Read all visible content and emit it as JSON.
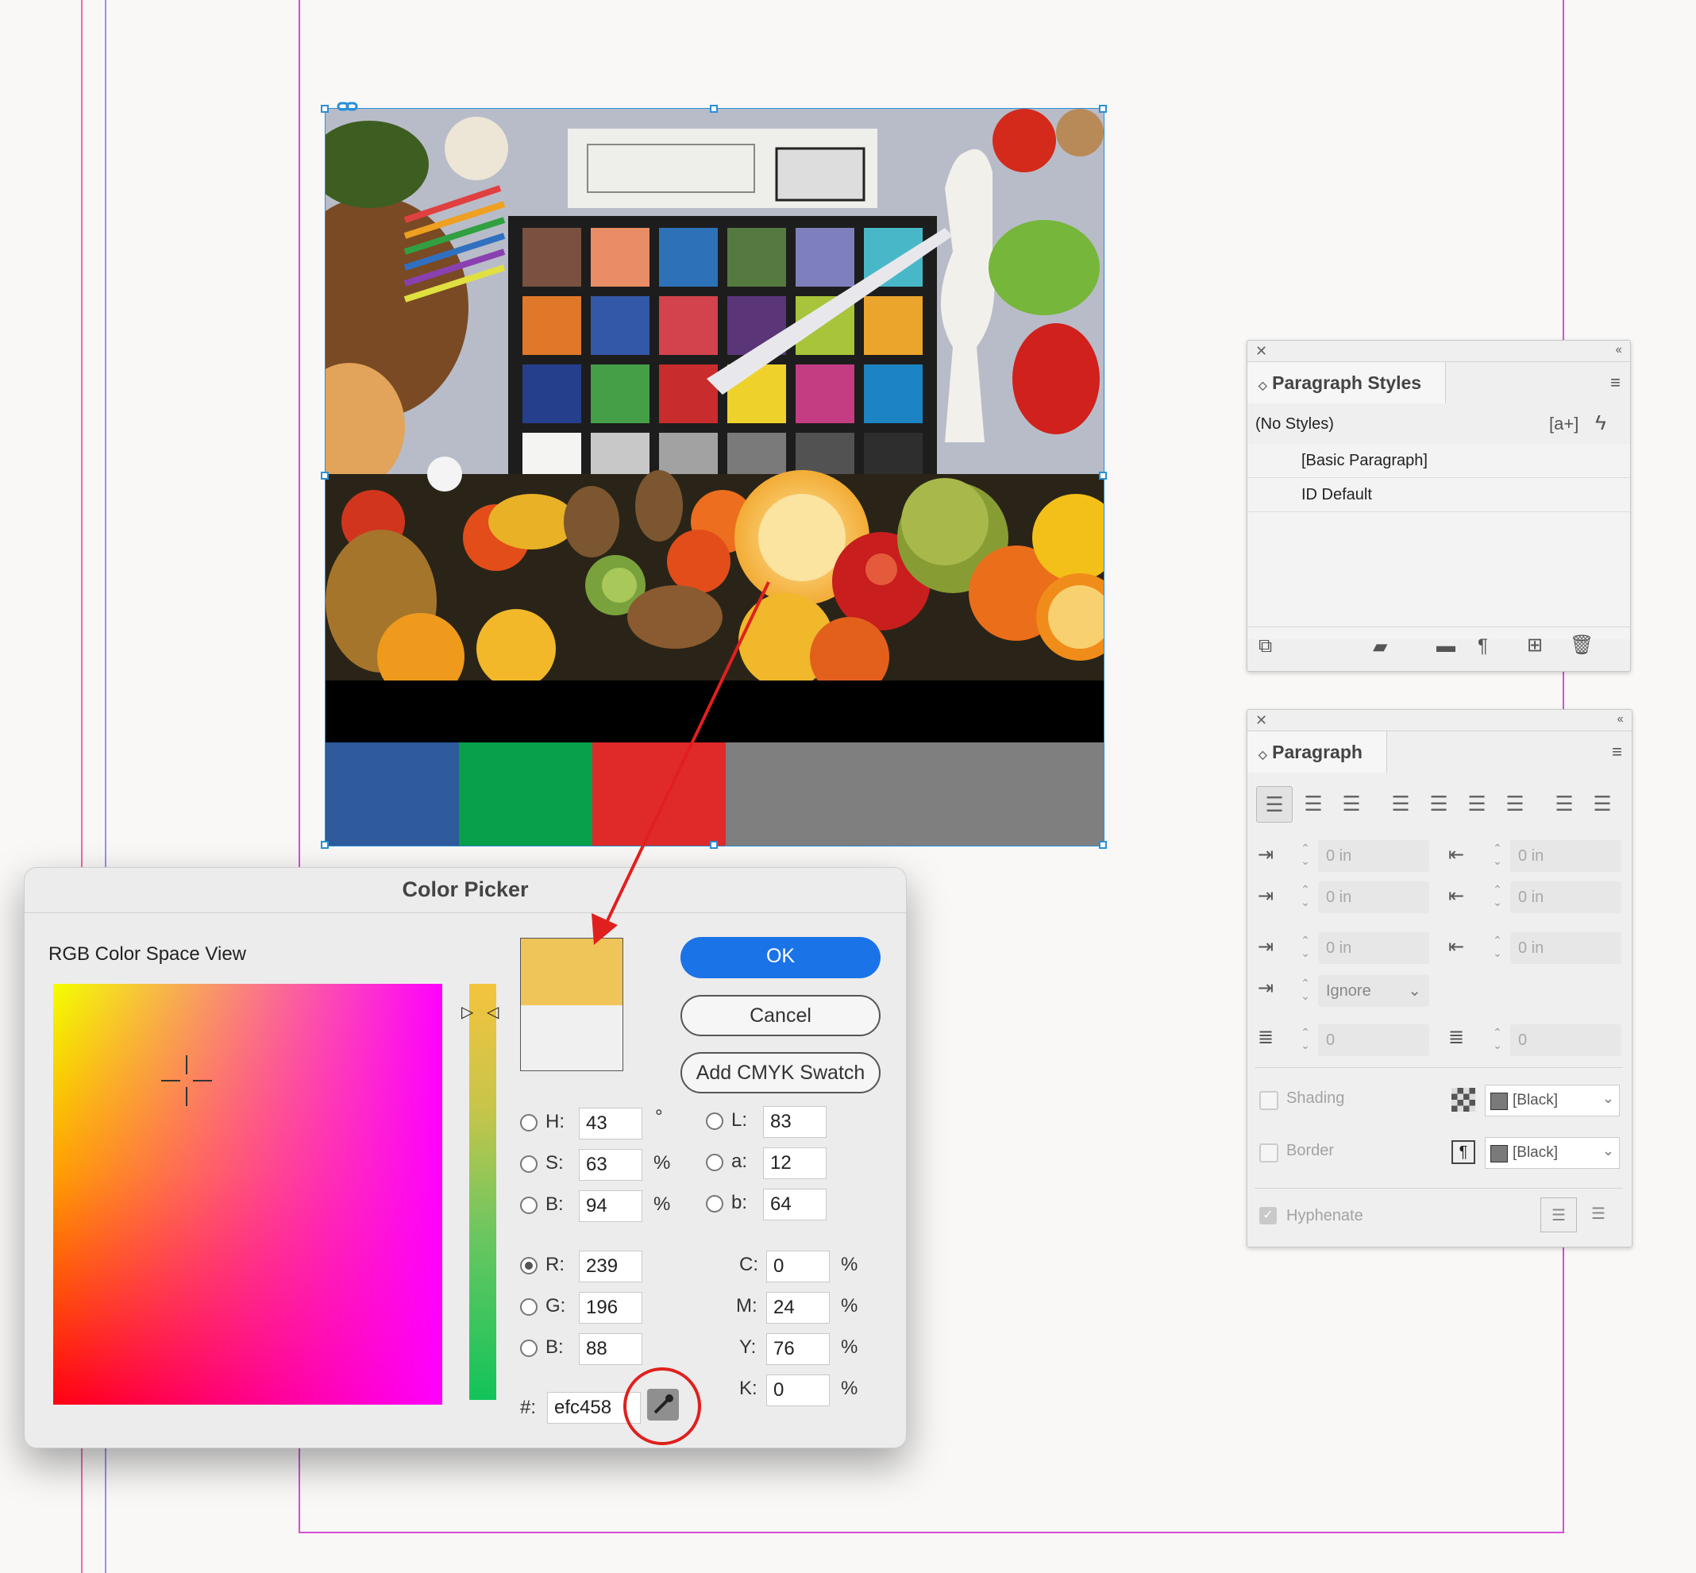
{
  "colors": {
    "accent": "#1b73e8",
    "guide_magenta": "#d54fd8",
    "guide_pink": "#f06aa8",
    "selected_color": "#efc458",
    "original_color": "#f0f0f0",
    "annotation_red": "#e0201e"
  },
  "document": {
    "color_bars": [
      "#2f5a9c",
      "#08a04a",
      "#e02a2a",
      "#7f7f7f"
    ],
    "checker_swatches": [
      "#7a5140",
      "#e88d66",
      "#2d72b8",
      "#557a3f",
      "#7e80bd",
      "#48b8c8",
      "#e0782a",
      "#3458a8",
      "#d3434d",
      "#5a3578",
      "#a8c43a",
      "#eba52c",
      "#263f8c",
      "#449f47",
      "#c92c2c",
      "#eed22b",
      "#c43d82",
      "#1c84c2",
      "#f4f4f2",
      "#c8c8c8",
      "#a2a2a2",
      "#7a7a7a",
      "#525252",
      "#2e2e2e"
    ]
  },
  "paragraph_styles_panel": {
    "title": "Paragraph Styles",
    "current": "(No Styles)",
    "quick_apply_label": "[a+]",
    "items": [
      "[Basic Paragraph]",
      "ID Default"
    ]
  },
  "paragraph_panel": {
    "title": "Paragraph",
    "left_indent": "0 in",
    "right_indent": "0 in",
    "first_line_indent": "0 in",
    "last_line_indent": "0 in",
    "space_before": "0 in",
    "space_after": "0 in",
    "align_to_grid": "Ignore",
    "drop_cap_lines": "0",
    "drop_cap_chars": "0",
    "shading_label": "Shading",
    "shading_color": "[Black]",
    "border_label": "Border",
    "border_color": "[Black]",
    "hyphenate_label": "Hyphenate"
  },
  "color_picker": {
    "title": "Color Picker",
    "view_label": "RGB Color Space View",
    "ok_label": "OK",
    "cancel_label": "Cancel",
    "add_swatch_label": "Add CMYK Swatch",
    "hsb": {
      "H": "43",
      "S": "63",
      "B": "94"
    },
    "lab": {
      "L": "83",
      "a": "12",
      "b": "64"
    },
    "rgb": {
      "R": "239",
      "G": "196",
      "B": "88"
    },
    "cmyk": {
      "C": "0",
      "M": "24",
      "Y": "76",
      "K": "0"
    },
    "hex": "efc458",
    "labels": {
      "h": "H:",
      "s": "S:",
      "br": "B:",
      "l": "L:",
      "a": "a:",
      "lb": "b:",
      "r": "R:",
      "g": "G:",
      "b": "B:",
      "c": "C:",
      "m": "M:",
      "y": "Y:",
      "k": "K:",
      "hash": "#:",
      "degree": "°",
      "percent": "%"
    }
  }
}
